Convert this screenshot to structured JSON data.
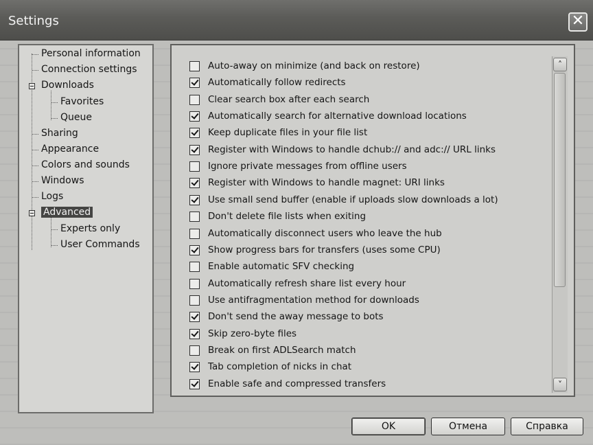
{
  "window": {
    "title": "Settings",
    "close_glyph": "✕"
  },
  "tree": {
    "items": [
      {
        "label": "Personal information"
      },
      {
        "label": "Connection settings"
      },
      {
        "label": "Downloads"
      },
      {
        "label": "Favorites"
      },
      {
        "label": "Queue"
      },
      {
        "label": "Sharing"
      },
      {
        "label": "Appearance"
      },
      {
        "label": "Colors and sounds"
      },
      {
        "label": "Windows"
      },
      {
        "label": "Logs"
      },
      {
        "label": "Advanced",
        "selected": true
      },
      {
        "label": "Experts only"
      },
      {
        "label": "User Commands"
      }
    ]
  },
  "options": [
    {
      "label": "Auto-away on minimize (and back on restore)",
      "checked": false
    },
    {
      "label": "Automatically follow redirects",
      "checked": true
    },
    {
      "label": "Clear search box after each search",
      "checked": false
    },
    {
      "label": "Automatically search for alternative download locations",
      "checked": true
    },
    {
      "label": "Keep duplicate files in your file list",
      "checked": true
    },
    {
      "label": "Register with Windows to handle dchub:// and adc:// URL links",
      "checked": true
    },
    {
      "label": "Ignore private messages from offline users",
      "checked": false
    },
    {
      "label": "Register with Windows to handle magnet: URI links",
      "checked": true
    },
    {
      "label": "Use small send buffer (enable if uploads slow downloads a lot)",
      "checked": true
    },
    {
      "label": "Don't delete file lists when exiting",
      "checked": false
    },
    {
      "label": "Automatically disconnect users who leave the hub",
      "checked": false
    },
    {
      "label": "Show progress bars for transfers (uses some CPU)",
      "checked": true
    },
    {
      "label": "Enable automatic SFV checking",
      "checked": false
    },
    {
      "label": "Automatically refresh share list every hour",
      "checked": false
    },
    {
      "label": "Use antifragmentation method for downloads",
      "checked": false
    },
    {
      "label": "Don't send the away message to bots",
      "checked": true
    },
    {
      "label": "Skip zero-byte files",
      "checked": true
    },
    {
      "label": "Break on first ADLSearch match",
      "checked": false
    },
    {
      "label": "Tab completion of nicks in chat",
      "checked": true
    },
    {
      "label": "Enable safe and compressed transfers",
      "checked": true
    }
  ],
  "scrollbar": {
    "up_glyph": "˄",
    "down_glyph": "˅"
  },
  "buttons": {
    "ok": "OK",
    "cancel": "Отмена",
    "help": "Справка"
  }
}
